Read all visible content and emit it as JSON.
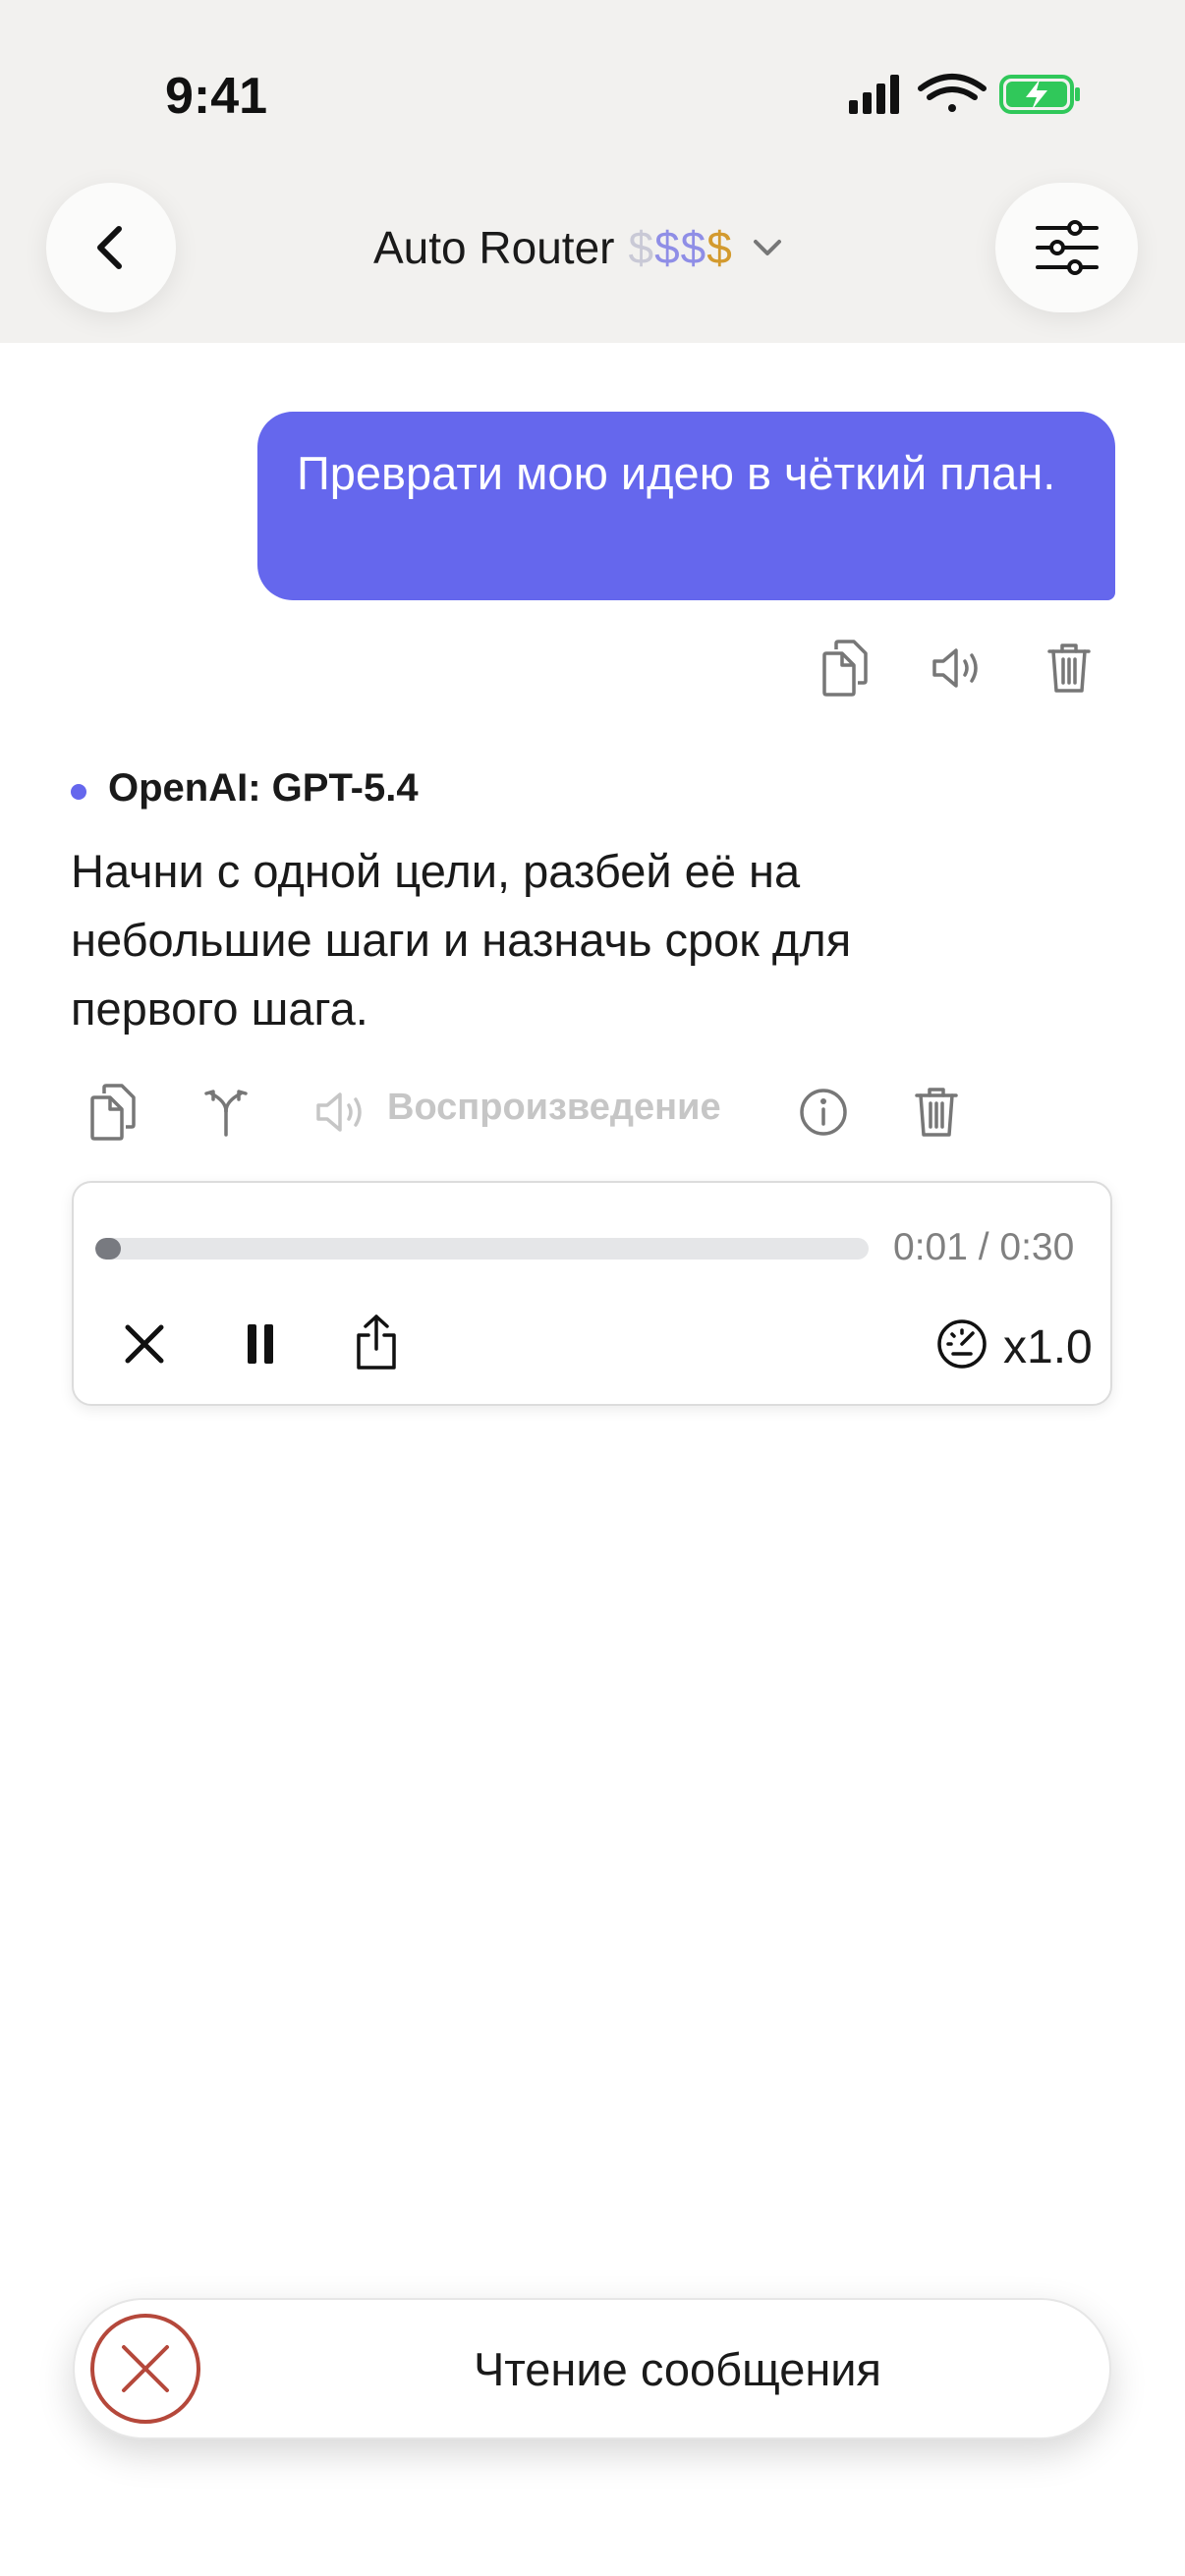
{
  "status_bar": {
    "time": "9:41"
  },
  "header": {
    "title": "Auto Router",
    "price_symbols": [
      "$",
      "$",
      "$",
      "$"
    ],
    "price_colors": [
      "#c9c9d6",
      "#8f8ee6",
      "#8f8ee6",
      "#d39a2e"
    ],
    "icons": {
      "back": "chevron-left-icon",
      "settings": "sliders-icon",
      "dropdown": "chevron-down-icon"
    }
  },
  "user_message": {
    "text": "Преврати мою идею в чёткий план.",
    "actions": [
      "copy-icon",
      "speaker-icon",
      "trash-icon"
    ]
  },
  "assistant_message": {
    "model": "OpenAI: GPT-5.4",
    "text": "Начни с одной цели, разбей её на небольшие шаги и назначь срок для первого шага.",
    "playback_label": "Воспроизведение",
    "actions": [
      "copy-icon",
      "branch-icon",
      "speaker-icon",
      "info-icon",
      "trash-icon"
    ]
  },
  "player": {
    "time": "0:01 / 0:30",
    "progress": 0.033,
    "speed": "x1.0",
    "icons": [
      "close-icon",
      "pause-icon",
      "share-icon",
      "gauge-icon"
    ]
  },
  "toast": {
    "text": "Чтение сообщения",
    "icon": "cancel-icon",
    "icon_color": "#b5483b"
  },
  "colors": {
    "accent": "#6567ed",
    "battery": "#30c85a"
  }
}
